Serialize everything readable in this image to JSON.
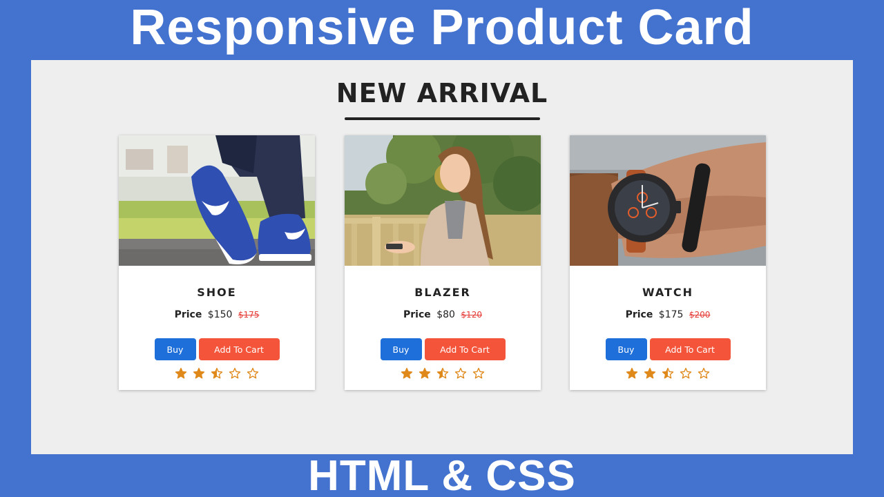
{
  "banner": {
    "top_title": "Responsive Product Card",
    "bottom_title": "HTML & CSS"
  },
  "section": {
    "heading": "NEW ARRIVAL"
  },
  "colors": {
    "banner_bg": "#4472cf",
    "stage_bg": "#eeeeee",
    "buy_button": "#1e6fd9",
    "cart_button": "#f4553a",
    "star": "#e0891b",
    "old_price": "#e53935"
  },
  "cards": [
    {
      "name": "SHOE",
      "image_icon": "blue-sneaker-photo",
      "price_label": "Price",
      "price": "$150",
      "old_price": "$175",
      "buy_label": "Buy",
      "cart_label": "Add To Cart",
      "rating": 2.5
    },
    {
      "name": "BLAZER",
      "image_icon": "woman-in-blazer-photo",
      "price_label": "Price",
      "price": "$80",
      "old_price": "$120",
      "buy_label": "Buy",
      "cart_label": "Add To Cart",
      "rating": 2.5
    },
    {
      "name": "WATCH",
      "image_icon": "wrist-watch-photo",
      "price_label": "Price",
      "price": "$175",
      "old_price": "$200",
      "buy_label": "Buy",
      "cart_label": "Add To Cart",
      "rating": 2.5
    }
  ]
}
